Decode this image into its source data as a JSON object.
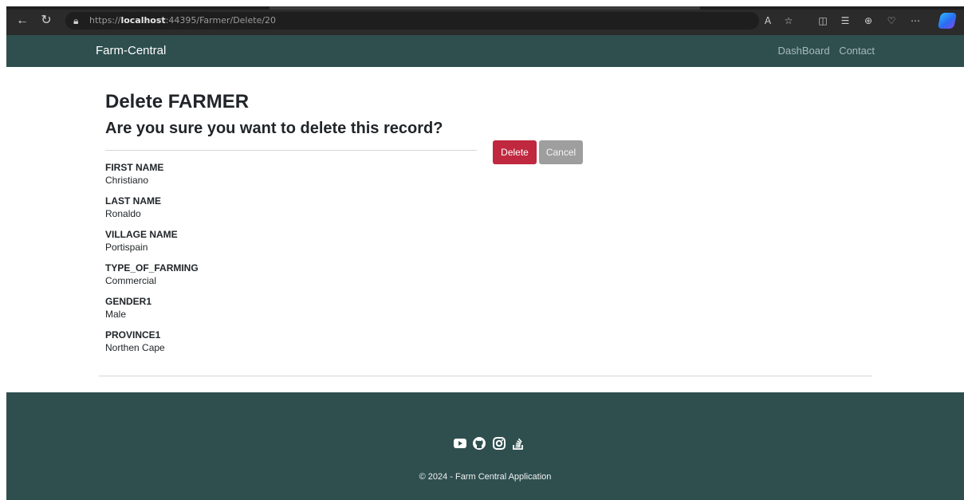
{
  "browser": {
    "url_prefix": "https://",
    "url_host": "localhost",
    "url_rest": ":44395/Farmer/Delete/20"
  },
  "navbar": {
    "brand": "Farm-Central",
    "links": [
      "DashBoard",
      "Contact"
    ]
  },
  "page": {
    "title": "Delete FARMER",
    "subtitle": "Are you sure you want to delete this record?",
    "delete_label": "Delete",
    "cancel_label": "Cancel",
    "fields": [
      {
        "label": "FIRST NAME",
        "value": "Christiano"
      },
      {
        "label": "LAST NAME",
        "value": "Ronaldo"
      },
      {
        "label": "VILLAGE NAME",
        "value": "Portispain"
      },
      {
        "label": "TYPE_OF_FARMING",
        "value": "Commercial"
      },
      {
        "label": "GENDER1",
        "value": "Male"
      },
      {
        "label": "PROVINCE1",
        "value": "Northen Cape"
      }
    ]
  },
  "footer": {
    "social_icons": [
      "youtube-icon",
      "github-icon",
      "instagram-icon",
      "stack-overflow-icon"
    ],
    "copyright": "© 2024 - Farm Central Application"
  },
  "colors": {
    "navbar_bg": "#2f4f4f",
    "delete_button": "#c0283f",
    "cancel_button": "#9e9e9e"
  }
}
